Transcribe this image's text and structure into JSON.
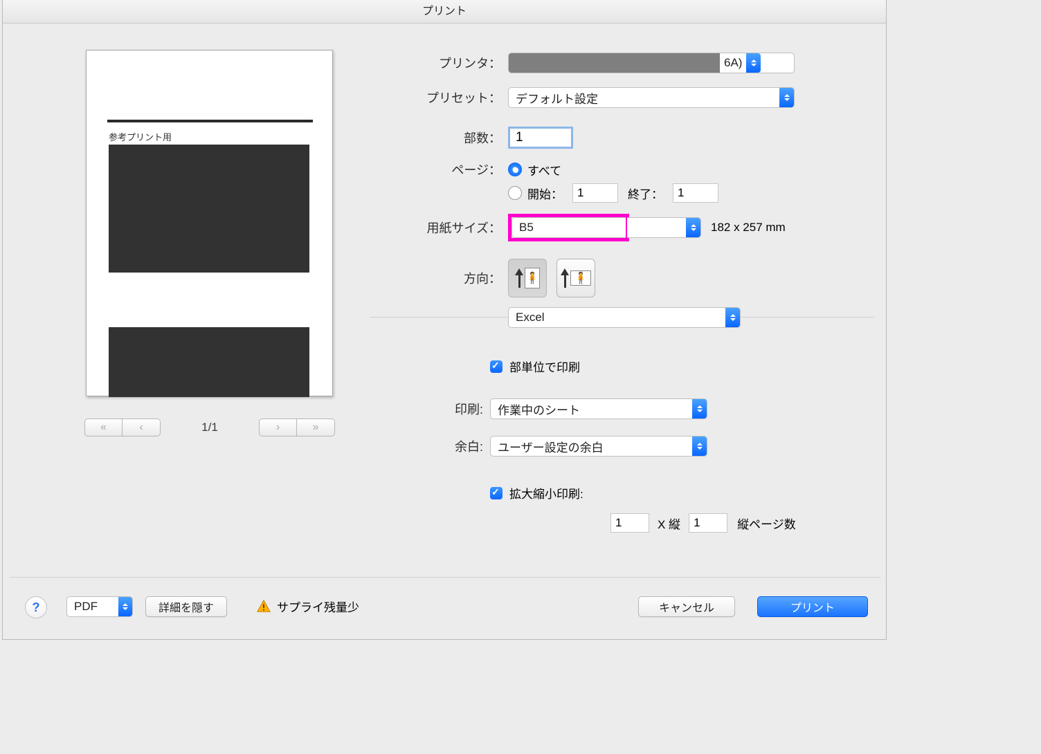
{
  "title": "プリント",
  "labels": {
    "printer": "プリンタ：",
    "preset": "プリセット：",
    "copies": "部数：",
    "pages": "ページ：",
    "all": "すべて",
    "from": "開始：",
    "to": "終了：",
    "paperSize": "用紙サイズ：",
    "orientation": "方向：",
    "collate": "部単位で印刷",
    "print": "印刷:",
    "margins": "余白:",
    "scale": "拡大縮小印刷:",
    "xVert": "X 縦",
    "vertPages": "縦ページ数"
  },
  "printer": {
    "suffix": "6A)"
  },
  "preset": "デフォルト設定",
  "copies": "1",
  "from": "1",
  "to": "1",
  "paperSize": "B5",
  "paperDim": "182 x 257 mm",
  "appSection": "Excel",
  "printWhat": "作業中のシート",
  "margins": "ユーザー設定の余白",
  "scaleW": "1",
  "scaleH": "1",
  "preview": {
    "caption": "参考プリント用",
    "counter": "1/1"
  },
  "footer": {
    "pdf": "PDF",
    "hideDetails": "詳細を隠す",
    "supplyLow": "サプライ残量少",
    "cancel": "キャンセル",
    "print": "プリント"
  }
}
